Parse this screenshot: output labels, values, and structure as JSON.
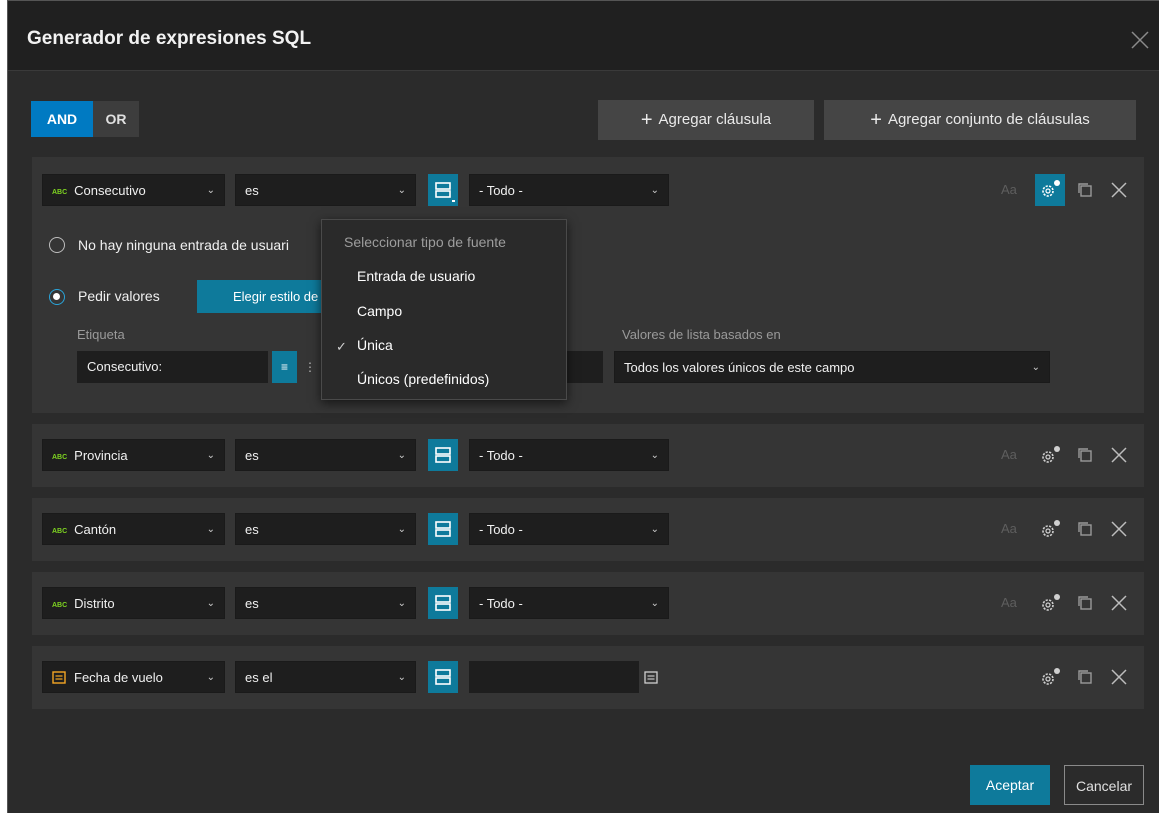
{
  "dialog": {
    "title": "Generador de expresiones SQL"
  },
  "toolbar": {
    "and_label": "AND",
    "or_label": "OR",
    "add_clause_label": "Agregar cláusula",
    "add_clause_set_label": "Agregar conjunto de cláusulas"
  },
  "clauses": [
    {
      "field": "Consecutivo",
      "field_type": "ABC",
      "operator": "es",
      "value": "- Todo -"
    },
    {
      "field": "Provincia",
      "field_type": "ABC",
      "operator": "es",
      "value": "- Todo -"
    },
    {
      "field": "Cantón",
      "field_type": "ABC",
      "operator": "es",
      "value": "- Todo -"
    },
    {
      "field": "Distrito",
      "field_type": "ABC",
      "operator": "es",
      "value": "- Todo -"
    },
    {
      "field": "Fecha de vuelo",
      "field_type": "date",
      "operator": "es el",
      "value": ""
    }
  ],
  "case_label": "Aa",
  "expanded": {
    "option_no_input": "No hay ninguna entrada de usuari",
    "option_ask_values": "Pedir valores",
    "choose_style_label": "Elegir estilo de",
    "label_caption": "Etiqueta",
    "label_value": "Consecutivo:",
    "list_values_caption": "Valores de lista basados en",
    "list_values_selected": "Todos los valores únicos de este campo"
  },
  "source_popup": {
    "header": "Seleccionar tipo de fuente",
    "items": [
      "Entrada de usuario",
      "Campo",
      "Única",
      "Únicos (predefinidos)"
    ],
    "selected_index": 2
  },
  "footer": {
    "ok_label": "Aceptar",
    "cancel_label": "Cancelar"
  },
  "colors": {
    "accent": "#007ac2",
    "teal": "#0e7a9b",
    "dialog_bg": "#2b2b2b",
    "clause_bg": "#353535"
  }
}
